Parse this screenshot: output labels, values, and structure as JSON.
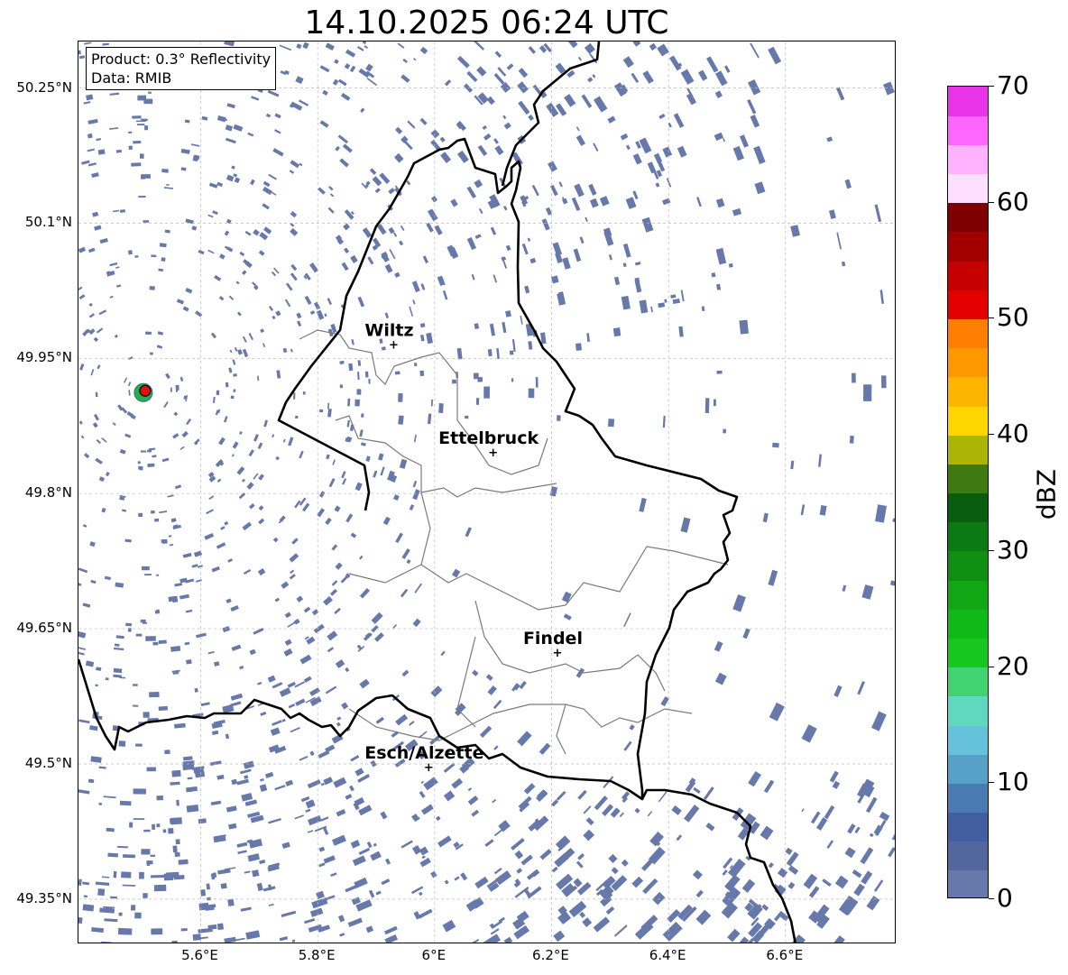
{
  "title": "14.10.2025 06:24 UTC",
  "info": {
    "product": "Product: 0.3° Reflectivity",
    "data": "Data: RMIB"
  },
  "lat_labels": [
    "50.25°N",
    "50.1°N",
    "49.95°N",
    "49.8°N",
    "49.65°N",
    "49.5°N",
    "49.35°N"
  ],
  "lat_values": [
    50.25,
    50.1,
    49.95,
    49.8,
    49.65,
    49.5,
    49.35
  ],
  "lon_labels": [
    "5.6°E",
    "5.8°E",
    "6°E",
    "6.2°E",
    "6.4°E",
    "6.6°E"
  ],
  "lon_values": [
    5.6,
    5.8,
    6.0,
    6.2,
    6.4,
    6.6
  ],
  "cities": [
    {
      "name": "Wiltz",
      "lon": 5.93,
      "lat": 49.966
    },
    {
      "name": "Ettelbruck",
      "lon": 6.1,
      "lat": 49.846
    },
    {
      "name": "Findel",
      "lon": 6.21,
      "lat": 49.624
    },
    {
      "name": "Esch/Alzette",
      "lon": 5.99,
      "lat": 49.497
    }
  ],
  "radar_site": {
    "lon": 5.505,
    "lat": 49.914
  },
  "colorbar": {
    "label": "dBZ",
    "min": 0,
    "max": 70,
    "ticks": [
      "0",
      "10",
      "20",
      "30",
      "40",
      "50",
      "60",
      "70"
    ],
    "colors": [
      "#6679aa",
      "#51679e",
      "#415fa0",
      "#4a7ab2",
      "#57a0c8",
      "#65c2da",
      "#60d8c0",
      "#40d370",
      "#18c620",
      "#10b818",
      "#11a614",
      "#0f8e12",
      "#0b7a12",
      "#085e0e",
      "#3f7a10",
      "#aab504",
      "#ffd700",
      "#fdb500",
      "#ff9800",
      "#ff7f00",
      "#e50000",
      "#c60000",
      "#a20000",
      "#7f0000",
      "#ffdfff",
      "#ffb3ff",
      "#ff66ff",
      "#e933e9"
    ]
  }
}
